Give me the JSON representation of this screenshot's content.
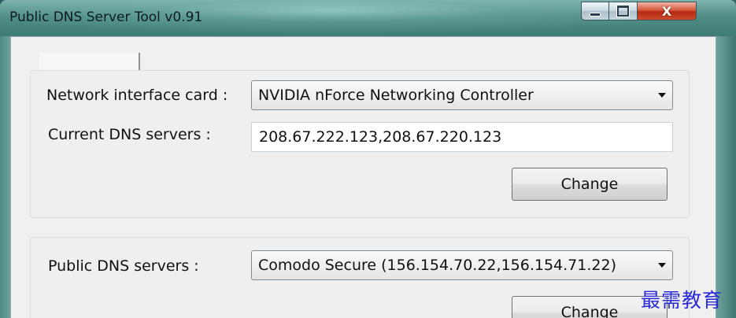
{
  "window": {
    "title": "Public DNS Server Tool v0.91",
    "caption": {
      "close_glyph": "X"
    }
  },
  "nic_group": {
    "nic_label": "Network interface card :",
    "nic_value": "NVIDIA nForce Networking Controller",
    "current_label": "Current DNS servers :",
    "current_value": "208.67.222.123,208.67.220.123",
    "change_label": "Change"
  },
  "public_group": {
    "public_label": "Public DNS servers :",
    "public_value": "Comodo Secure (156.154.70.22,156.154.71.22)",
    "change_label": "Change"
  },
  "watermark": "最需教育",
  "colors": {
    "aero_glass": "#4f8d86",
    "client_bg": "#f0f0f0",
    "close_button": "#c8391c",
    "watermark": "#2a2ad8"
  }
}
